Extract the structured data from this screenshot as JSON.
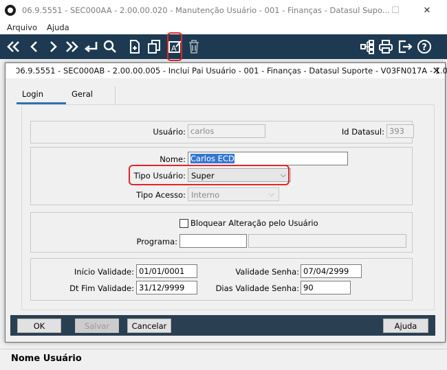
{
  "window": {
    "title": "06.9.5551 - SEC000AA - 2.00.00.020 - Manutenção Usuário - 001 - Finanças - Datasul Supo..."
  },
  "menu": [
    "Arquivo",
    "Ajuda"
  ],
  "toolbar": {
    "left_icons": [
      "first-icon",
      "previous-icon",
      "next-icon",
      "last-icon",
      "goto-icon",
      "search-icon",
      "new-icon",
      "copy-icon",
      "edit-icon",
      "delete-icon"
    ],
    "right_icons": [
      "structure-icon",
      "print-icon",
      "exit-icon",
      "help-icon"
    ]
  },
  "dialog": {
    "title": "06.9.5551 - SEC000AB - 2.00.00.005 - Inclui Pai Usuário - 001 - Finanças - Datasul Suporte - V03FN017A - 1.00.0...",
    "tabs": [
      "Login",
      "Geral"
    ],
    "usuario": {
      "label": "Usuário:",
      "value": "carlos"
    },
    "id_datasul": {
      "label": "Id Datasul:",
      "value": "393"
    },
    "nome": {
      "label": "Nome:",
      "value": "Carlos ECD"
    },
    "tipo_usuario": {
      "label": "Tipo Usuário:",
      "value": "Super"
    },
    "tipo_acesso": {
      "label": "Tipo Acesso:",
      "value": "Interno"
    },
    "bloquear": {
      "label": "Bloquear Alteração pelo Usuário",
      "checked": false
    },
    "programa": {
      "label": "Programa:",
      "value": "",
      "desc": ""
    },
    "inicio_validade": {
      "label": "Início Validade:",
      "value": "01/01/0001"
    },
    "validade_senha": {
      "label": "Validade Senha:",
      "value": "07/04/2999"
    },
    "dt_fim_validade": {
      "label": "Dt Fim Validade:",
      "value": "31/12/9999"
    },
    "dias_validade_senha": {
      "label": "Dias Validade Senha:",
      "value": "90"
    },
    "buttons": {
      "ok": "OK",
      "salvar": "Salvar",
      "cancelar": "Cancelar",
      "ajuda": "Ajuda"
    }
  },
  "status": {
    "text": "Nome Usuário"
  },
  "colors": {
    "toolbar_bg": "#1d3a52",
    "button_bar_bg": "#2a3f52",
    "highlight": "#e0262a",
    "selection": "#3476d2"
  }
}
